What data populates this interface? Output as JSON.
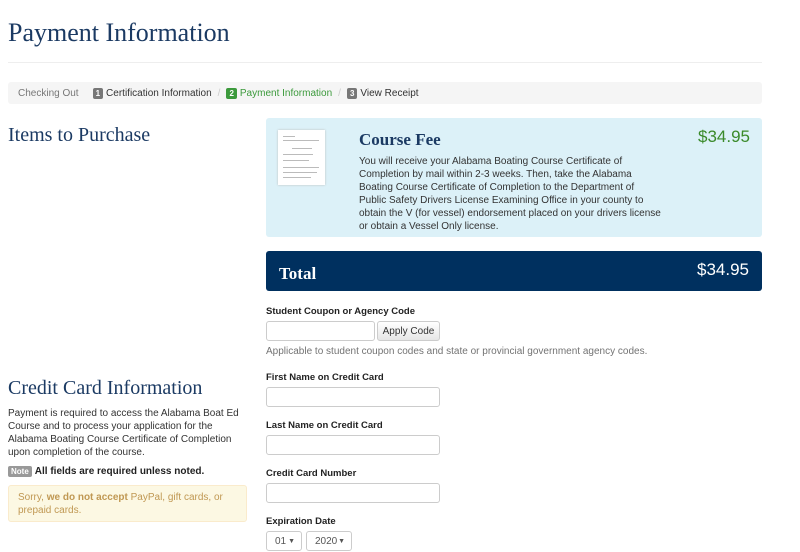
{
  "page": {
    "title": "Payment Information"
  },
  "breadcrumb": {
    "start": "Checking Out",
    "steps": [
      {
        "num": "1",
        "label": "Certification Information"
      },
      {
        "num": "2",
        "label": "Payment Information"
      },
      {
        "num": "3",
        "label": "View Receipt"
      }
    ]
  },
  "items": {
    "heading": "Items to Purchase",
    "course_fee": {
      "title": "Course Fee",
      "price": "$34.95",
      "description": "You will receive your Alabama Boating Course Certificate of Completion by mail within 2-3 weeks. Then, take the Alabama Boating Course Certificate of Completion to the Department of Public Safety Drivers License Examining Office in your county to obtain the V (for vessel) endorsement placed on your drivers license or obtain a Vessel Only license."
    },
    "total_label": "Total",
    "total_price": "$34.95"
  },
  "coupon": {
    "label": "Student Coupon or Agency Code",
    "value": "",
    "apply": "Apply Code",
    "help": "Applicable to student coupon codes and state or provincial government agency codes."
  },
  "credit": {
    "heading": "Credit Card Information",
    "description": "Payment is required to access the Alabama Boat Ed Course and to process your application for the Alabama Boating Course Certificate of Completion upon completion of the course.",
    "note_badge": "Note",
    "note": "All fields are required unless noted.",
    "warning_pre": "Sorry, ",
    "warning_bold": "we do not accept",
    "warning_post": " PayPal, gift cards, or prepaid cards.",
    "first_name_label": "First Name on Credit Card",
    "first_name": "",
    "last_name_label": "Last Name on Credit Card",
    "last_name": "",
    "number_label": "Credit Card Number",
    "number": "",
    "expiration_label": "Expiration Date",
    "exp_month": "01",
    "exp_year": "2020"
  },
  "colors": {
    "heading": "#1b3a63",
    "total_bg": "#00305f",
    "fee_bg": "#dcf1f8",
    "price": "#3a8a2a",
    "active_step": "#3c9a3c"
  }
}
